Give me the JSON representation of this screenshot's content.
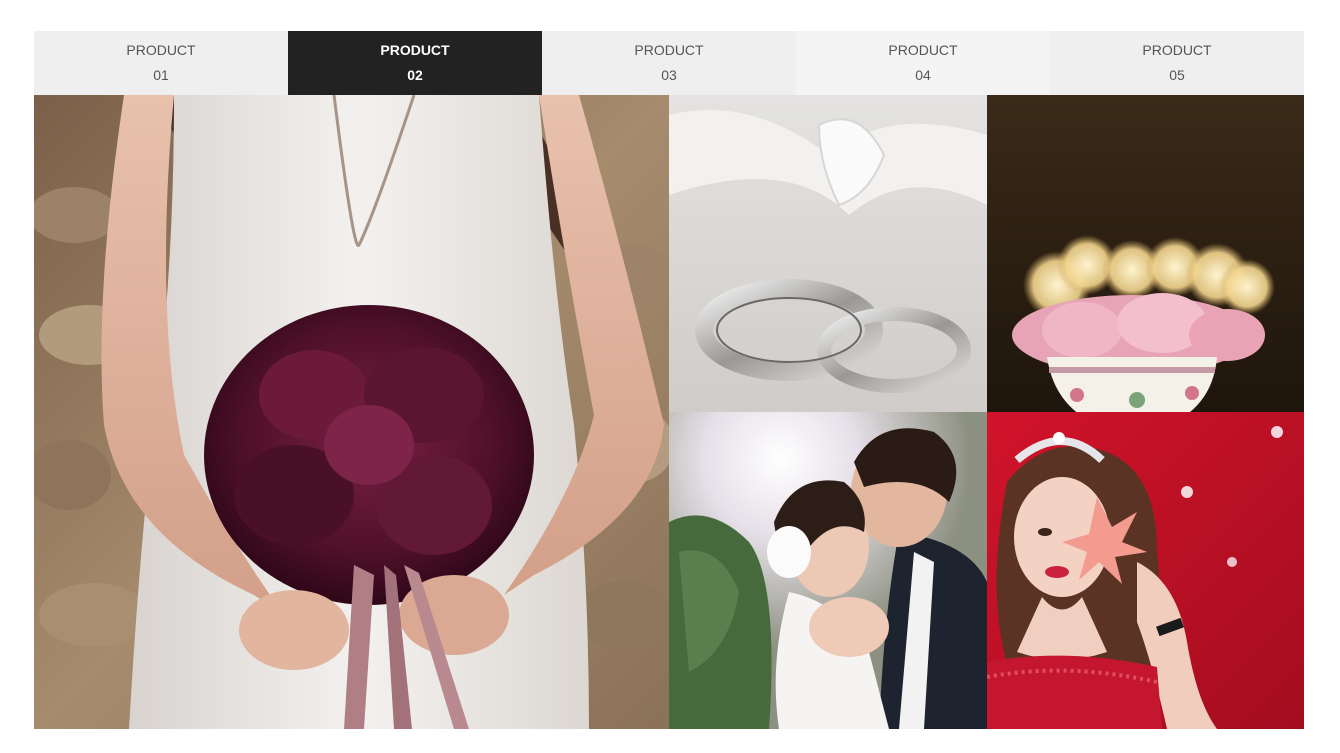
{
  "tabs": [
    {
      "label": "PRODUCT",
      "number": "01",
      "active": false
    },
    {
      "label": "PRODUCT",
      "number": "02",
      "active": true
    },
    {
      "label": "PRODUCT",
      "number": "03",
      "active": false
    },
    {
      "label": "PRODUCT",
      "number": "04",
      "active": false
    },
    {
      "label": "PRODUCT",
      "number": "05",
      "active": false
    }
  ],
  "gallery": {
    "images": [
      {
        "name": "bride-bouquet-photo"
      },
      {
        "name": "wedding-rings-photo"
      },
      {
        "name": "rose-teacup-photo"
      },
      {
        "name": "kissing-couple-photo"
      },
      {
        "name": "tiara-girl-photo"
      }
    ]
  },
  "colors": {
    "tab_background": "#efefef",
    "tab_active_background": "#222222",
    "tab_text": "#555555",
    "tab_active_text": "#ffffff"
  }
}
